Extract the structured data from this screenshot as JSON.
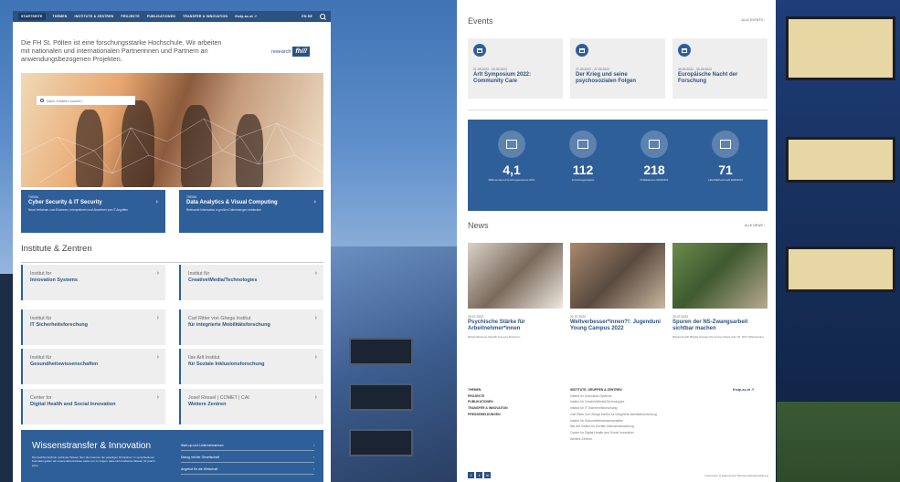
{
  "nav": {
    "items": [
      "STARTSEITE",
      "THEMEN",
      "INSTITUTE & ZENTREN",
      "PROJEKTE",
      "PUBLIKATIONEN",
      "TRANSFER & INNOVATION",
      "fhstp.ac.at ↗"
    ],
    "lang": "EN  DE"
  },
  "intro": "Die FH St. Pölten ist eine forschungsstarke Hochschule. Wir arbeiten mit nationalen und internationalen Partnerinnen und Partnern an anwendungsbezogenen Projekten.",
  "logo": {
    "prefix": "research",
    "mark": "fh///"
  },
  "hero": {
    "search_placeholder": "Nach Inhalten suchen"
  },
  "featured": [
    {
      "label": "THEMA",
      "title": "Cyber Security & IT Security",
      "desc": "Neue Verfahren zum Erkennen, Interpretieren und Abwehren von IT-Angriffen"
    },
    {
      "label": "THEMA",
      "title": "Data Analytics & Visual Computing",
      "desc": "Relevante Information in großen Datenmengen entdecken"
    }
  ],
  "institutes": {
    "title": "Institute & Zentren",
    "items": [
      {
        "line1": "Institut for",
        "line2": "Innovation Systems"
      },
      {
        "line1": "Institut für",
        "line2": "Creative\\Media/Technologies"
      },
      {
        "line1": "Institut für",
        "line2": "IT Sicherheitsforschung"
      },
      {
        "line1": "Carl Ritter von Ghega Institut",
        "line2": "für integrierte Mobilitätsforschung"
      },
      {
        "line1": "Institut für",
        "line2": "Gesundheitswissenschaften"
      },
      {
        "line1": "Ilse Arlt Institut",
        "line2": "für Soziale Inklusionsforschung"
      },
      {
        "line1": "Center for",
        "line2": "Digital Health and Social Innovation"
      },
      {
        "line1": "Josef Ressel | COMET | CAI",
        "line2": "Weitere Zentren"
      }
    ]
  },
  "transfer": {
    "title": "Wissenstransfer & Innovation",
    "desc": "Die Fachhochschule verbindet Wissen über die Grenzen der jeweiligen Disziplinen. In verschiedenen Formaten geben wir unsere Erkenntnisse weiter um zu zeigen, dass sich fundiertes Wissen für jede*n lohnt.",
    "links": [
      "Start-up und Unternehmertum",
      "Dialog mit der Gesellschaft",
      "Angebot für die Wirtschaft"
    ]
  },
  "events": {
    "title": "Events",
    "all": "ALLE EVENTS",
    "items": [
      {
        "date": "21.09.2022 - 22.09.2022",
        "title": "Arlt Symposium 2022: Community Care"
      },
      {
        "date": "27.09.2022 - 27.09.2022",
        "title": "Der Krieg und seine psychosozialen Folgen"
      },
      {
        "date": "30.09.2022 - 30.09.2022",
        "title": "Europäische Nacht der Forschung"
      }
    ]
  },
  "stats": [
    {
      "value": "4,1",
      "label": "Millionen Euro Forschungsvolumen 2021"
    },
    {
      "value": "112",
      "label": "Forschungsprojekte"
    },
    {
      "value": "218",
      "label": "Publikationen 2020/2021"
    },
    {
      "value": "71",
      "label": "Laborfläche/Anzahl 2020/2021"
    }
  ],
  "news": {
    "title": "News",
    "all": "ALLE NEWS",
    "items": [
      {
        "date": "25.07.2022",
        "title": "Psychische Stärke für Arbeitnehmer*innen",
        "tags": "#Digital Business  #Health Sciences  #Inclusion"
      },
      {
        "date": "21.07.2022",
        "title": "Weltverbesser*innen?!: Jugenduni Young Campus 2022",
        "tags": ""
      },
      {
        "date": "20.07.2022",
        "title": "Spuren der NS-Zwangsarbeit sichtbar machen",
        "tags": "#Digital Health  #Digital Heritage  #Immersive Media (AR, VR, 360°)  #Participation"
      }
    ]
  },
  "footer": {
    "col1": [
      "THEMEN",
      "PROJEKTE",
      "PUBLIKATIONEN",
      "TRANSFER & INNOVATION",
      "PRESSEMELDUNGEN"
    ],
    "col2_title": "INSTITUTE, GRUPPEN & ZENTREN",
    "col2": [
      "Institut for Innovation Systems",
      "Institut für Creative\\Media/Technologies",
      "Institut für IT Sicherheitsforschung",
      "Carl Ritter von Ghega Institut für integrierte Mobilitätsforschung",
      "Institut für Gesundheitswissenschaften",
      "Ilse Arlt Institut für Soziale Inklusionsforschung",
      "Center for Digital Health and Social Innovation",
      "Weitere Zentren"
    ],
    "fhstp": "fhstp.ac.at ↗",
    "legal": "Impressum & Datenschutz   Barrierefreiheitserklärung"
  },
  "colors": {
    "brand": "#2c5282",
    "tile": "#2f5f99"
  }
}
